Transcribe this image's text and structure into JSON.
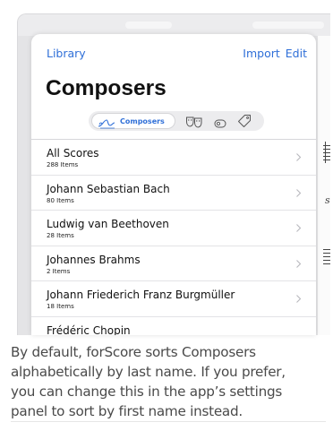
{
  "nav": {
    "back_label": "Library",
    "import_label": "Import",
    "edit_label": "Edit"
  },
  "title": "Composers",
  "segmented": {
    "active_label": "Composers",
    "items": [
      "composers-icon",
      "genres-icon",
      "labels-icon",
      "tags-icon"
    ]
  },
  "list": {
    "rows": [
      {
        "title": "All Scores",
        "subtitle": "288 Items"
      },
      {
        "title": "Johann Sebastian Bach",
        "subtitle": "80 Items"
      },
      {
        "title": "Ludwig van Beethoven",
        "subtitle": "28 Items"
      },
      {
        "title": "Johannes Brahms",
        "subtitle": "2 Items"
      },
      {
        "title": "Johann Friederich Franz Burgmüller",
        "subtitle": "18 Items"
      },
      {
        "title": "Frédéric Chopin",
        "subtitle": ""
      }
    ]
  },
  "caption": {
    "lines": [
      "By default, forScore sorts Composers",
      "alphabetically by last name. If you prefer,",
      "you can change this in the app’s settings",
      "panel to sort by first name instead."
    ]
  },
  "background_score": {
    "glyph": "s"
  },
  "colors": {
    "accent": "#2f6fd8",
    "caption_text": "#4a4a4a"
  }
}
